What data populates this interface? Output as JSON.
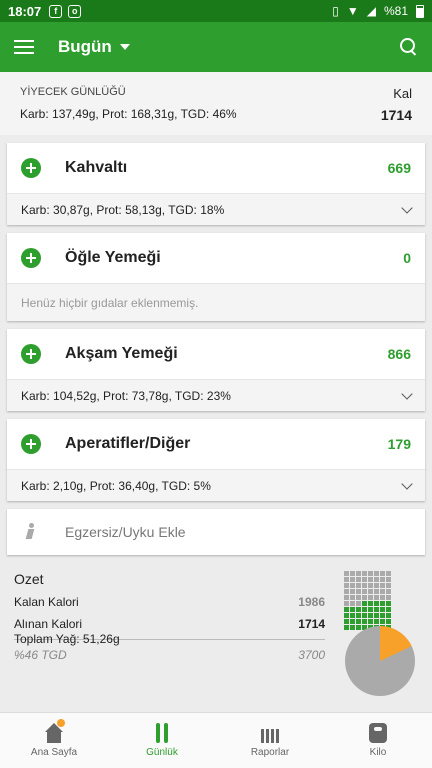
{
  "status": {
    "time": "18:07",
    "battery": "%81"
  },
  "appbar": {
    "title": "Bugün"
  },
  "diary": {
    "heading": "YİYECEK GÜNLÜĞÜ",
    "kal_label": "Kal",
    "macros": "Karb: 137,49g, Prot: 168,31g, TGD: 46%",
    "total": "1714"
  },
  "meals": [
    {
      "name": "Kahvaltı",
      "cal": "669",
      "macros": "Karb: 30,87g, Prot: 58,13g, TGD: 18%"
    },
    {
      "name": "Öğle Yemeği",
      "cal": "0",
      "empty": "Henüz hiçbir gıdalar eklenmemiş."
    },
    {
      "name": "Akşam Yemeği",
      "cal": "866",
      "macros": "Karb: 104,52g, Prot: 73,78g, TGD: 23%"
    },
    {
      "name": "Aperatifler/Diğer",
      "cal": "179",
      "macros": "Karb: 2,10g, Prot: 36,40g, TGD: 5%"
    }
  ],
  "exercise": {
    "label": "Egzersiz/Uyku Ekle"
  },
  "summary": {
    "title": "Ozet",
    "remaining_label": "Kalan Kalori",
    "remaining_value": "1986",
    "consumed_label": "Alınan Kalori",
    "consumed_value": "1714",
    "tgd_label": "%46 TGD",
    "tgd_value": "3700",
    "fat_label": "Toplam Yağ: 51,26g"
  },
  "nav": [
    {
      "label": "Ana Sayfa"
    },
    {
      "label": "Günlük"
    },
    {
      "label": "Raporlar"
    },
    {
      "label": "Kilo"
    }
  ]
}
